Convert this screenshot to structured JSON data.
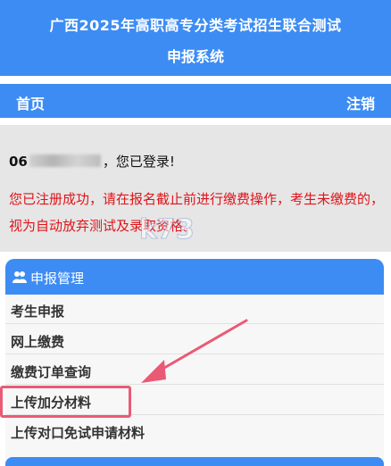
{
  "header": {
    "title_line1": "广西2025年高职高专分类考试招生联合测试",
    "title_line2": "申报系统"
  },
  "nav": {
    "home": "首页",
    "logout": "注销"
  },
  "notice": {
    "user_prefix": "06",
    "user_suffix": "，您已登录!",
    "message": "您已注册成功，请在报名截止前进行缴费操作，考生未缴费的，视为自动放弃测试及录取资格。"
  },
  "panel": {
    "title": "申报管理",
    "icon": "user-group-icon",
    "items": [
      {
        "label": "考生申报"
      },
      {
        "label": "网上缴费"
      },
      {
        "label": "缴费订单查询"
      },
      {
        "label": "上传加分材料"
      },
      {
        "label": "上传对口免试申请材料"
      }
    ]
  },
  "watermark_text": "k73",
  "colors": {
    "primary": "#3d8cf3",
    "alert_text": "#e0141a",
    "highlight": "#ea5a74"
  }
}
